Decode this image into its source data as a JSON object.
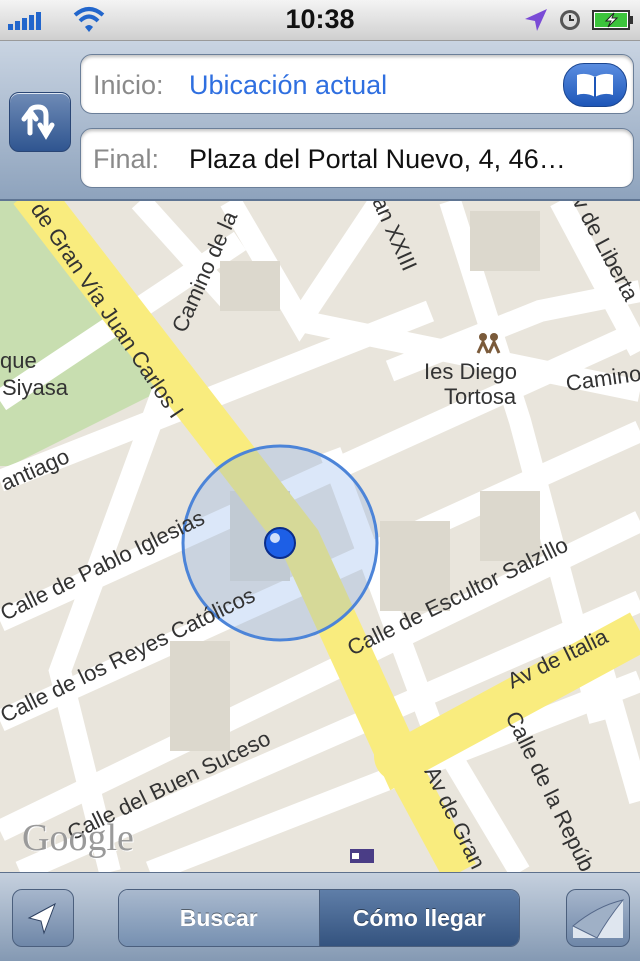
{
  "status_bar": {
    "time": "10:38",
    "icons": [
      "signal-bars-icon",
      "wifi-icon",
      "location-arrow-icon",
      "clock-icon",
      "battery-charging-icon"
    ]
  },
  "route": {
    "start_label": "Inicio:",
    "start_value": "Ubicación actual",
    "end_label": "Final:",
    "end_value": "Plaza del Portal Nuevo, 4, 46…",
    "colors": {
      "start_value": "#2f6fe0",
      "end_value": "#111111"
    }
  },
  "map": {
    "labels": {
      "gran_via": "de Gran Vía Juan Carlos I",
      "camino_1": "Camino de la",
      "juan_xxiii": "an XXIII",
      "libertad": "v de Liberta",
      "parque": "que",
      "siyasa": "Siyasa",
      "diego_1": "Ies Diego",
      "diego_2": "Tortosa",
      "camino_2": "Camino",
      "santiago": "antiago",
      "pablo_iglesias": "Calle de Pablo Iglesias",
      "reyes_catolicos": "Calle de los Reyes Católicos",
      "escultor_salzillo": "Calle de Escultor Salzillo",
      "italia": "Av de Italia",
      "buen_suceso": "Calle del Buen Suceso",
      "republica": "Calle de la Repúb",
      "av_gran": "Av de Gran",
      "google": "Google"
    }
  },
  "toolbar": {
    "buscar": "Buscar",
    "como_llegar": "Cómo llegar",
    "active_segment": "Cómo llegar"
  }
}
